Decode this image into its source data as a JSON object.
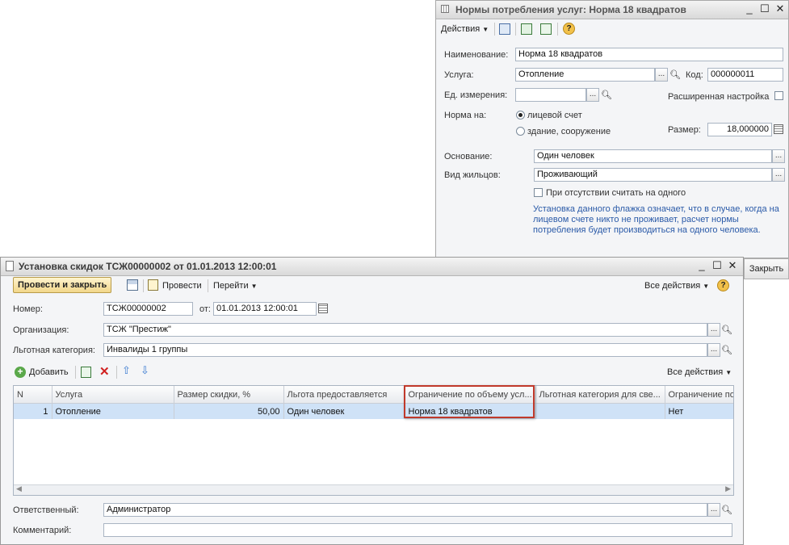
{
  "norm_window": {
    "title": "Нормы потребления услуг: Норма 18 квадратов",
    "actions_label": "Действия",
    "name_label": "Наименование:",
    "name_value": "Норма 18 квадратов",
    "service_label": "Услуга:",
    "service_value": "Отопление",
    "code_label": "Код:",
    "code_value": "000000011",
    "unit_label": "Ед. измерения:",
    "unit_value": "",
    "advanced_label": "Расширенная настройка",
    "norm_on_label": "Норма на:",
    "radio_account": "лицевой счет",
    "radio_building": "здание, сооружение",
    "size_label": "Размер:",
    "size_value": "18,000000",
    "basis_label": "Основание:",
    "basis_value": "Один человек",
    "residents_label": "Вид жильцов:",
    "residents_value": "Проживающий",
    "absent_label": "При отсутствии считать на одного",
    "note_line1": "Установка данного флажка означает, что в случае, когда на",
    "note_line2": "лицевом счете никто не проживает, расчет нормы",
    "note_line3": "потребления будет производиться на одного человека.",
    "close_label": "Закрыть"
  },
  "discount_window": {
    "title": "Установка скидок ТСЖ00000002 от 01.01.2013 12:00:01",
    "post_close_label": "Провести и закрыть",
    "post_label": "Провести",
    "goto_label": "Перейти",
    "all_actions_label": "Все действия",
    "number_label": "Номер:",
    "number_value": "ТСЖ00000002",
    "from_label": "от:",
    "date_value": "01.01.2013 12:00:01",
    "org_label": "Организация:",
    "org_value": "ТСЖ \"Престиж\"",
    "category_label": "Льготная категория:",
    "category_value": "Инвалиды 1 группы",
    "add_label": "Добавить",
    "table_all_actions_label": "Все действия",
    "columns": [
      "N",
      "Услуга",
      "Размер скидки, %",
      "Льгота предоставляется",
      "Ограничение по объему усл...",
      "Льготная категория для све...",
      "Ограничение по"
    ],
    "rows": [
      {
        "n": "1",
        "service": "Отопление",
        "discount": "50,00",
        "provided": "Один человек",
        "limit": "Норма 18 квадратов",
        "category": "",
        "restriction": "Нет"
      }
    ],
    "responsible_label": "Ответственный:",
    "responsible_value": "Администратор",
    "comment_label": "Комментарий:",
    "comment_value": ""
  },
  "colors": {
    "highlight": "#c0392b",
    "note": "#2a5aa8",
    "selected_row": "#cfe2f7"
  }
}
